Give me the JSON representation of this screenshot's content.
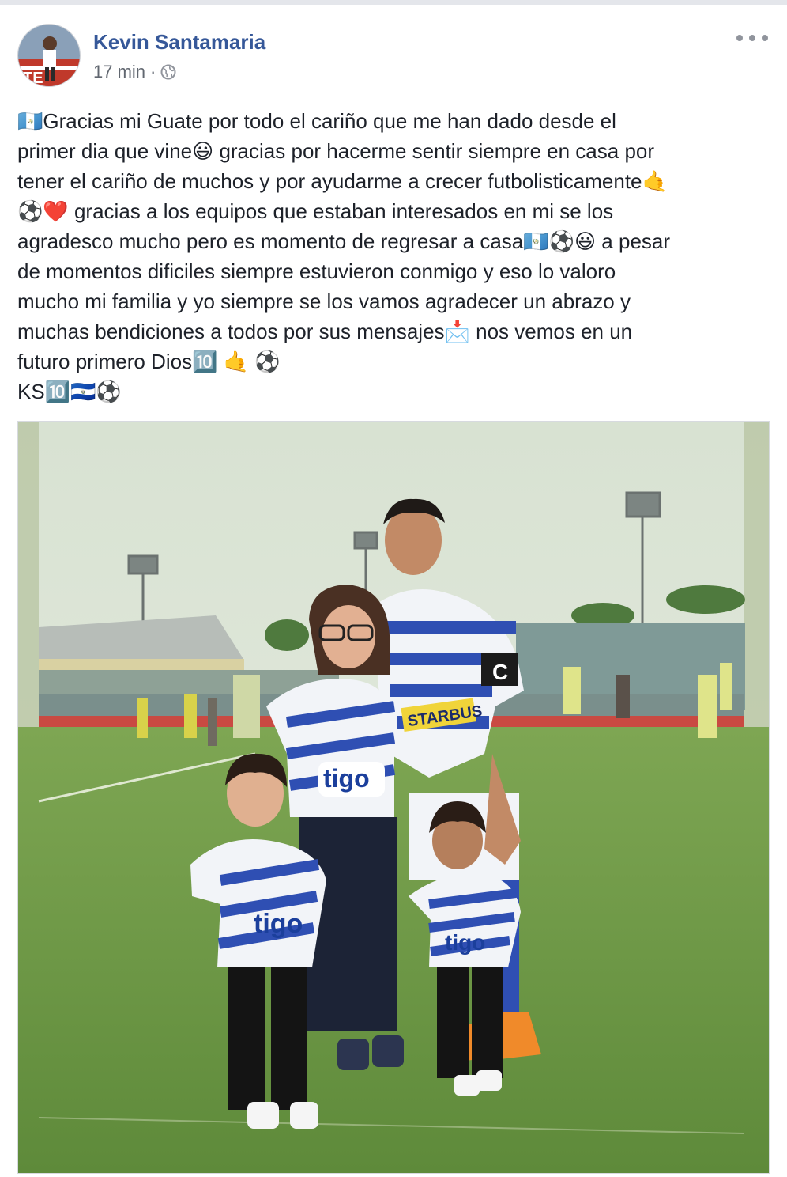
{
  "post": {
    "author": "Kevin Santamaria",
    "time": "17 min",
    "separator": "·",
    "privacy_icon": "globe-icon",
    "more_icon": "more-options-icon",
    "lines": [
      "🇬🇹Gracias mi Guate por todo el cariño que me han dado desde el",
      "primer dia que vine😃 gracias por hacerme sentir siempre en casa por",
      "tener el cariño de muchos y por ayudarme a crecer futbolisticamente🤙",
      "⚽❤️ gracias a los equipos que estaban interesados en mi se los",
      "agradesco mucho pero es momento de regresar a casa🇬🇹⚽😃 a pesar",
      "de momentos dificiles siempre estuvieron conmigo y eso lo valoro",
      "mucho mi familia y yo siempre se los vamos agradecer un abrazo y",
      "muchas bendiciones a todos por sus mensajes📩 nos vemos en un",
      "futuro primero Dios🔟 🤙 ⚽",
      "KS🔟🇸🇻⚽"
    ]
  },
  "photo": {
    "jersey_sponsor": "tigo",
    "jersey_sponsor_player": "STARBUS",
    "captain_band": "C"
  },
  "colors": {
    "author": "#365899",
    "meta": "#616770",
    "text": "#1d2129",
    "pitch": "#6f9a45",
    "jersey_blue": "#2f4fb3",
    "sky": "#dfe6da"
  }
}
